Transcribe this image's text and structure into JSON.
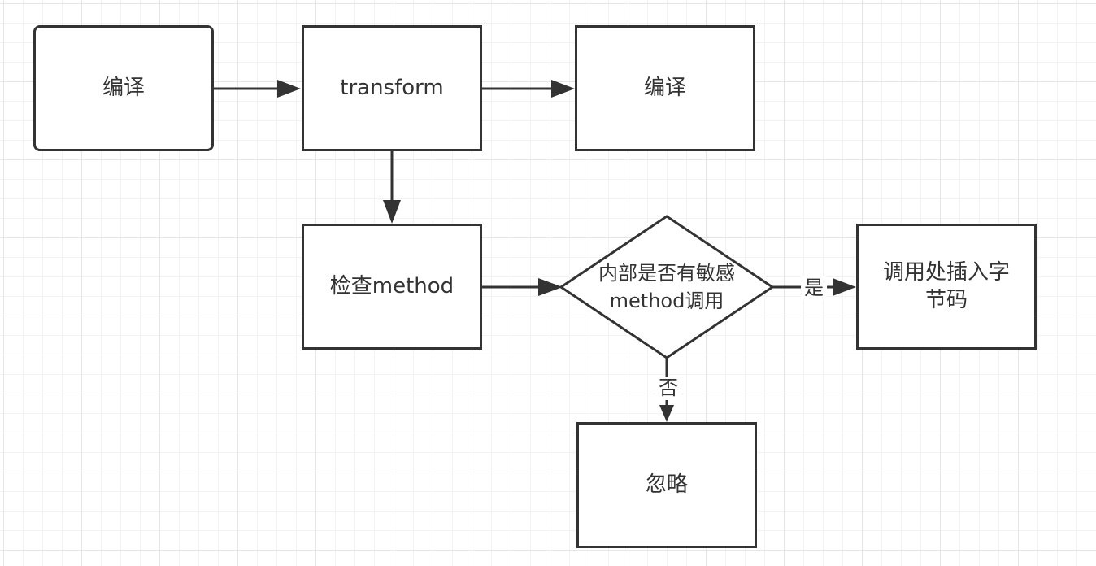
{
  "diagram": {
    "nodes": {
      "compile_start": "编译",
      "transform": "transform",
      "compile_end": "编译",
      "check_method": "检查method",
      "decision": "内部是否有敏感method调用",
      "insert_bytecode": "调用处插入字节码",
      "ignore": "忽略"
    },
    "edge_labels": {
      "yes": "是",
      "no": "否"
    },
    "colors": {
      "stroke": "#333333",
      "grid": "#e6e6e6",
      "background": "#ffffff"
    }
  }
}
